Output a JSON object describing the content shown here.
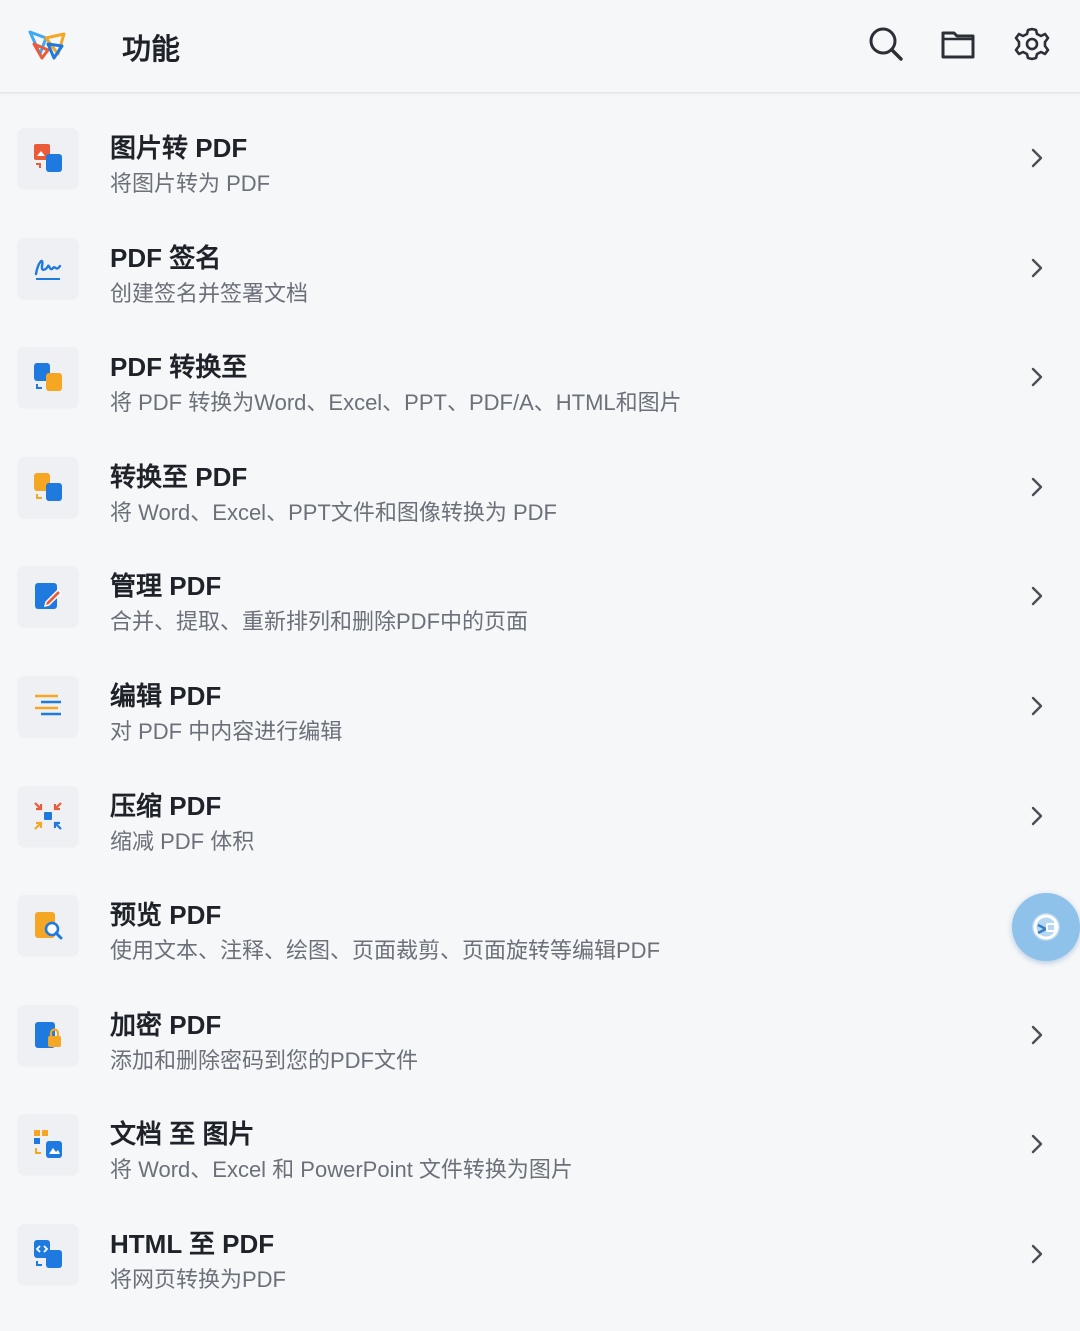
{
  "header": {
    "title": "功能",
    "icons": [
      "app-logo-icon",
      "search-icon",
      "folder-icon",
      "gear-icon"
    ]
  },
  "colors": {
    "background": "#f6f7f9",
    "brand_blue": "#1f7ae0",
    "brand_orange": "#f5a623",
    "brand_red": "#ea5b3a",
    "text_primary": "#1f2329",
    "text_secondary": "#6b7079"
  },
  "features": [
    {
      "name": "图片转 PDF",
      "desc": "将图片转为 PDF",
      "icon": "image-to-pdf-icon"
    },
    {
      "name": "PDF 签名",
      "desc": "创建签名并签署文档",
      "icon": "signature-icon"
    },
    {
      "name": "PDF 转换至",
      "desc": "将 PDF 转换为Word、Excel、PPT、PDF/A、HTML和图片",
      "icon": "pdf-convert-icon"
    },
    {
      "name": "转换至 PDF",
      "desc": "将 Word、Excel、PPT文件和图像转换为 PDF",
      "icon": "convert-to-pdf-icon"
    },
    {
      "name": "管理 PDF",
      "desc": "合并、提取、重新排列和删除PDF中的页面",
      "icon": "manage-pdf-icon"
    },
    {
      "name": "编辑 PDF",
      "desc": "对 PDF 中内容进行编辑",
      "icon": "edit-pdf-icon"
    },
    {
      "name": "压缩 PDF",
      "desc": "缩减 PDF 体积",
      "icon": "compress-icon"
    },
    {
      "name": "预览 PDF",
      "desc": "使用文本、注释、绘图、页面裁剪、页面旋转等编辑PDF",
      "icon": "preview-icon"
    },
    {
      "name": "加密 PDF",
      "desc": "添加和删除密码到您的PDF文件",
      "icon": "lock-icon"
    },
    {
      "name": "文档 至 图片",
      "desc": "将 Word、Excel 和 PowerPoint 文件转换为图片",
      "icon": "doc-to-image-icon"
    },
    {
      "name": "HTML 至 PDF",
      "desc": "将网页转换为PDF",
      "icon": "html-to-pdf-icon"
    }
  ],
  "floating_button": {
    "icon": "assistant-icon"
  }
}
